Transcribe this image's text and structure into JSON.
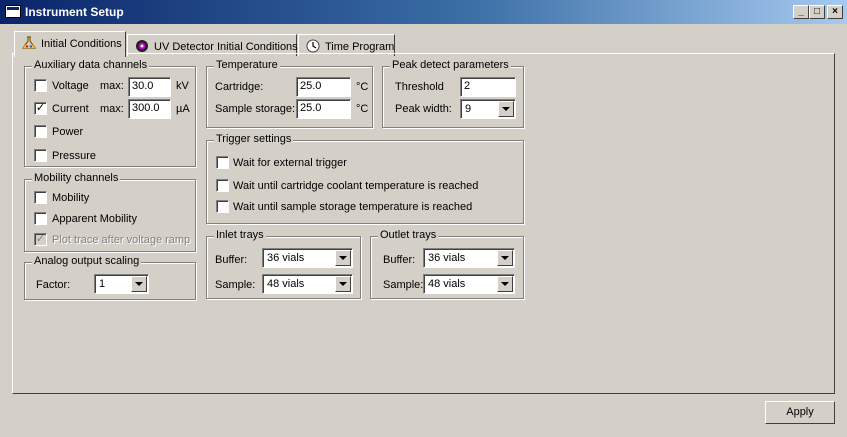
{
  "window": {
    "title": "Instrument Setup",
    "controls": {
      "minimize": "_",
      "maximize": "□",
      "close": "×"
    }
  },
  "tabs": [
    {
      "label": "Initial Conditions",
      "icon": "flask-icon",
      "active": true
    },
    {
      "label": "UV Detector Initial Conditions",
      "icon": "uv-detector-icon",
      "active": false
    },
    {
      "label": "Time Program",
      "icon": "clock-icon",
      "active": false
    }
  ],
  "auxiliary": {
    "title": "Auxiliary data channels",
    "voltage": {
      "label": "Voltage",
      "checked": false,
      "max_label": "max:",
      "max_value": "30.0",
      "unit": "kV"
    },
    "current": {
      "label": "Current",
      "checked": true,
      "max_label": "max:",
      "max_value": "300.0",
      "unit": "µA"
    },
    "power": {
      "label": "Power",
      "checked": false
    },
    "pressure": {
      "label": "Pressure",
      "checked": false
    }
  },
  "mobility": {
    "title": "Mobility channels",
    "mobility": {
      "label": "Mobility",
      "checked": false
    },
    "apparent": {
      "label": "Apparent Mobility",
      "checked": false
    },
    "plot_trace": {
      "label": "Plot trace after voltage ramp",
      "checked": true,
      "disabled": true
    }
  },
  "analog": {
    "title": "Analog output scaling",
    "factor_label": "Factor:",
    "factor_value": "1"
  },
  "temperature": {
    "title": "Temperature",
    "cartridge_label": "Cartridge:",
    "cartridge_value": "25.0",
    "cartridge_unit": "°C",
    "storage_label": "Sample storage:",
    "storage_value": "25.0",
    "storage_unit": "°C"
  },
  "peak": {
    "title": "Peak detect parameters",
    "threshold_label": "Threshold",
    "threshold_value": "2",
    "width_label": "Peak width:",
    "width_value": "9"
  },
  "trigger": {
    "title": "Trigger settings",
    "external": {
      "label": "Wait for external trigger",
      "checked": false
    },
    "coolant": {
      "label": "Wait until cartridge coolant temperature is reached",
      "checked": false
    },
    "storage": {
      "label": "Wait until sample storage temperature is reached",
      "checked": false
    }
  },
  "inlet": {
    "title": "Inlet trays",
    "buffer_label": "Buffer:",
    "buffer_value": "36 vials",
    "sample_label": "Sample:",
    "sample_value": "48 vials"
  },
  "outlet": {
    "title": "Outlet trays",
    "buffer_label": "Buffer:",
    "buffer_value": "36 vials",
    "sample_label": "Sample:",
    "sample_value": "48 vials"
  },
  "apply_label": "Apply"
}
